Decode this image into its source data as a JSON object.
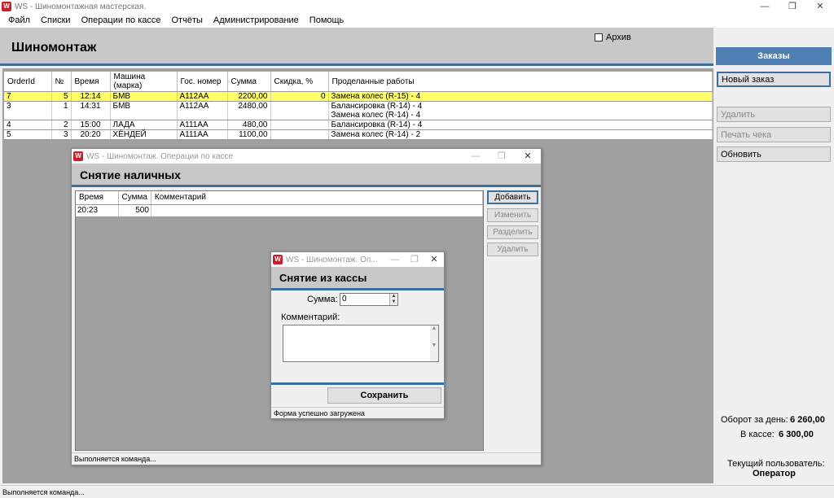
{
  "app": {
    "window_title": "WS - Шиномонтажная мастерская.",
    "icon_text": "W",
    "controls": [
      "—",
      "❐",
      "✕"
    ]
  },
  "menu": [
    "Файл",
    "Списки",
    "Операции по кассе",
    "Отчёты",
    "Администрирование",
    "Помощь"
  ],
  "header": {
    "title": "Шиномонтаж",
    "archive_label": "Архив"
  },
  "right_panel": {
    "tab": "Заказы",
    "new_order": "Новый заказ",
    "delete": "Удалить",
    "print_check": "Печать чека",
    "refresh": "Обновить",
    "turnover_label": "Оборот за день:",
    "turnover_value": "6 260,00",
    "cash_label": "В кассе:",
    "cash_value": "6 300,00",
    "user_label": "Текущий пользователь:",
    "user_value": "Оператор"
  },
  "orders": {
    "columns": [
      "OrderId",
      "№",
      "Время",
      "Машина (марка)",
      "Гос. номер",
      "Сумма",
      "Скидка, %",
      "Проделанные работы"
    ],
    "rows": [
      {
        "id": "7",
        "n": "5",
        "time": "12:14",
        "car": "БМВ",
        "plate": "А112АА",
        "sum": "2200,00",
        "discount": "0",
        "works": [
          "Замена колес (R-15) - 4"
        ]
      },
      {
        "id": "3",
        "n": "1",
        "time": "14:31",
        "car": "БМВ",
        "plate": "А112АА",
        "sum": "2480,00",
        "discount": "",
        "works": [
          "Балансировка (R-14) - 4",
          "Замена колес (R-14) - 4"
        ]
      },
      {
        "id": "4",
        "n": "2",
        "time": "15:00",
        "car": "ЛАДА",
        "plate": "А111АА",
        "sum": "480,00",
        "discount": "",
        "works": [
          "Балансировка (R-14) - 4"
        ]
      },
      {
        "id": "5",
        "n": "3",
        "time": "20:20",
        "car": "ХЁНДЕЙ",
        "plate": "А111АА",
        "sum": "1100,00",
        "discount": "",
        "works": [
          "Замена колес (R-14) - 2"
        ]
      }
    ]
  },
  "cash_window": {
    "title": "WS - Шиномонтаж. Операции по кассе",
    "heading": "Снятие наличных",
    "columns": [
      "Время",
      "Сумма",
      "Комментарий"
    ],
    "rows": [
      {
        "time": "20:23",
        "sum": "500",
        "comment": ""
      }
    ],
    "add": "Добавить",
    "edit": "Изменить",
    "split": "Разделить",
    "delete": "Удалить",
    "status": "Выполняется команда..."
  },
  "withdraw_window": {
    "title": "WS - Шиномонтаж. Оп...",
    "heading": "Снятие из кассы",
    "sum_label": "Сумма:",
    "sum_value": "0",
    "comment_label": "Комментарий:",
    "save": "Сохранить",
    "status": "Форма успешно загружена"
  },
  "statusbar": "Выполняется команда..."
}
